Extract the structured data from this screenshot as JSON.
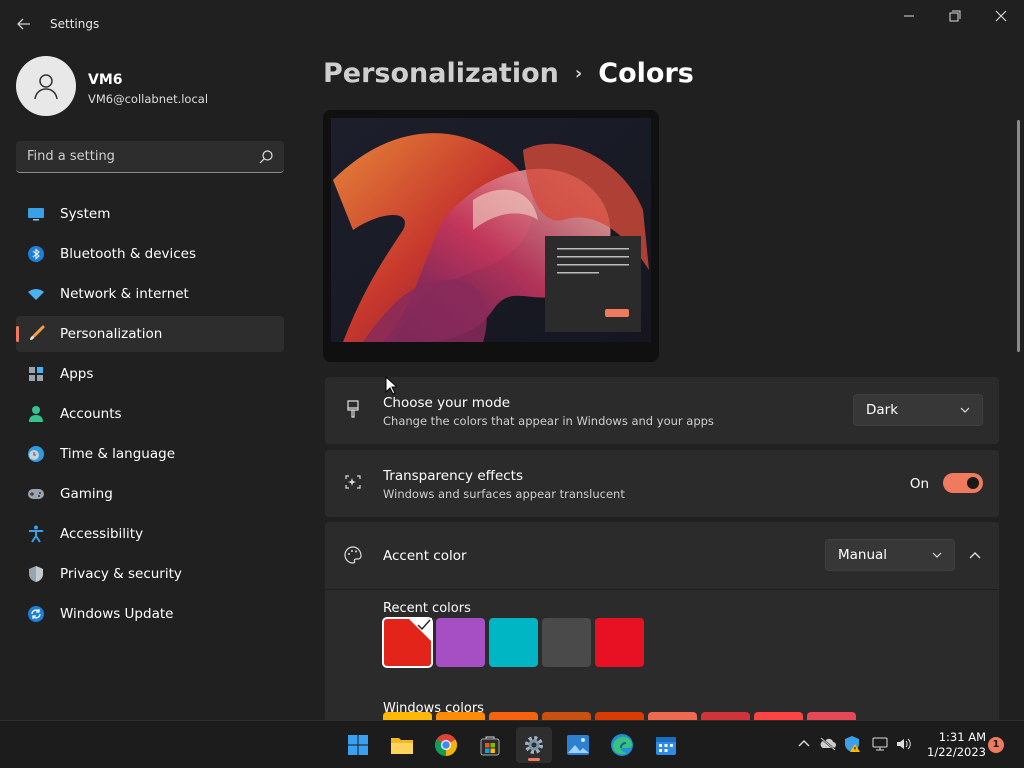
{
  "app": {
    "title": "Settings"
  },
  "user": {
    "name": "VM6",
    "email": "VM6@collabnet.local"
  },
  "search": {
    "placeholder": "Find a setting"
  },
  "nav": [
    {
      "label": "System",
      "icon": "monitor-icon"
    },
    {
      "label": "Bluetooth & devices",
      "icon": "bluetooth-icon"
    },
    {
      "label": "Network & internet",
      "icon": "wifi-icon"
    },
    {
      "label": "Personalization",
      "icon": "brush-icon",
      "selected": true
    },
    {
      "label": "Apps",
      "icon": "apps-icon"
    },
    {
      "label": "Accounts",
      "icon": "person-icon"
    },
    {
      "label": "Time & language",
      "icon": "globe-clock-icon"
    },
    {
      "label": "Gaming",
      "icon": "gamepad-icon"
    },
    {
      "label": "Accessibility",
      "icon": "accessibility-icon"
    },
    {
      "label": "Privacy & security",
      "icon": "shield-icon"
    },
    {
      "label": "Windows Update",
      "icon": "update-icon"
    }
  ],
  "breadcrumb": {
    "parent": "Personalization",
    "separator": "›",
    "current": "Colors"
  },
  "mode": {
    "title": "Choose your mode",
    "subtitle": "Change the colors that appear in Windows and your apps",
    "value": "Dark"
  },
  "transparency": {
    "title": "Transparency effects",
    "subtitle": "Windows and surfaces appear translucent",
    "state_label": "On",
    "on": true
  },
  "accent": {
    "title": "Accent color",
    "value": "Manual",
    "recent_label": "Recent colors",
    "recent_colors": [
      "#e3241b",
      "#a64fc4",
      "#00b6c4",
      "#4a4a4a",
      "#e81123"
    ],
    "windows_label": "Windows colors",
    "windows_colors": [
      "#ffb900",
      "#ff8c00",
      "#f7630c",
      "#ca5010",
      "#da3b01",
      "#ef6950",
      "#d13438",
      "#ff4343",
      "#e74856"
    ]
  },
  "colors": {
    "accent": "#f07a5e"
  },
  "taskbar": {
    "apps": [
      "start-icon",
      "file-explorer-icon",
      "chrome-icon",
      "store-icon",
      "settings-icon",
      "photos-icon",
      "edge-icon",
      "calendar-icon"
    ],
    "time": "1:31 AM",
    "date": "1/22/2023",
    "notifications": "1"
  }
}
